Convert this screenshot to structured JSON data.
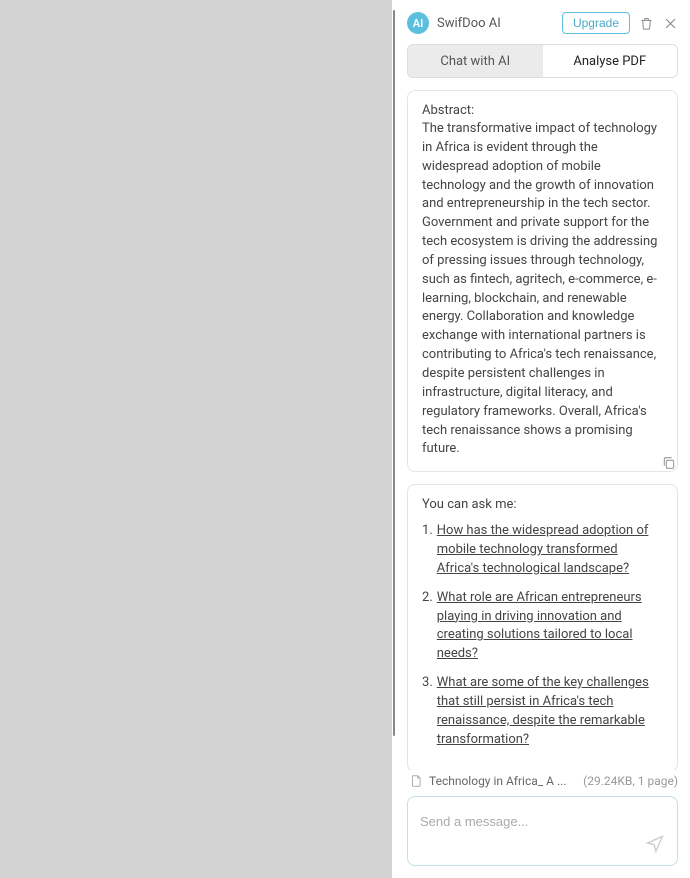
{
  "header": {
    "ai_badge": "AI",
    "title": "SwifDoo AI",
    "upgrade_label": "Upgrade"
  },
  "tabs": {
    "chat_label": "Chat with AI",
    "analyse_label": "Analyse PDF"
  },
  "abstract": {
    "label": "Abstract:",
    "body": "The transformative impact of technology in Africa is evident through the widespread adoption of mobile technology and the growth of innovation and entrepreneurship in the tech sector. Government and private support for the tech ecosystem is driving the addressing of pressing issues through technology, such as fintech, agritech, e-commerce, e-learning, blockchain, and renewable energy. Collaboration and knowledge exchange with international partners is contributing to Africa's tech renaissance, despite persistent challenges in infrastructure, digital literacy, and regulatory frameworks. Overall, Africa's tech renaissance shows a promising future."
  },
  "suggestions": {
    "label": "You can ask me:",
    "questions": [
      "How has the widespread adoption of mobile technology transformed Africa's technological landscape?",
      "What role are African entrepreneurs playing in driving innovation and creating solutions tailored to local needs?",
      "What are some of the key challenges that still persist in Africa's tech renaissance, despite the remarkable transformation?"
    ]
  },
  "file": {
    "name": "Technology in Africa_ A ...",
    "meta": "(29.24KB, 1 page)"
  },
  "input": {
    "placeholder": "Send a message..."
  }
}
